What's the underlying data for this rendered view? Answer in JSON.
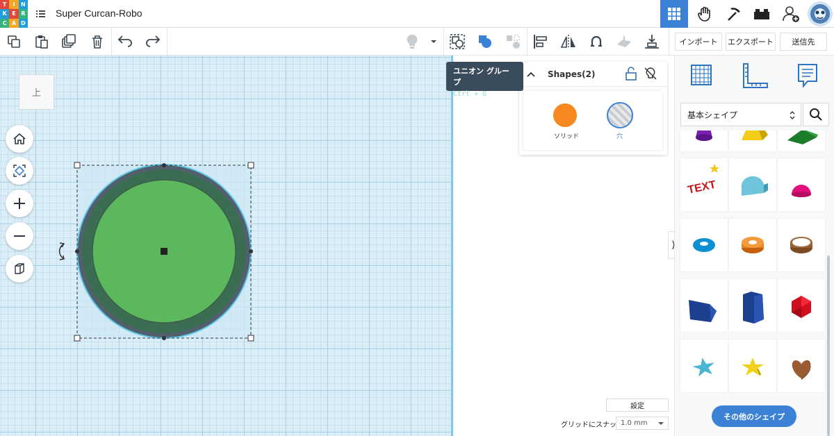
{
  "app": {
    "logo_letters": [
      "T",
      "I",
      "N",
      "K",
      "E",
      "R",
      "C",
      "A",
      "D"
    ],
    "project_title": "Super Curcan-Robo"
  },
  "toolbar": {
    "import_label": "インポート",
    "export_label": "エクスポート",
    "send_label": "送信先"
  },
  "viewcube": {
    "label": "上"
  },
  "tooltip": {
    "title": "ユニオン グループ",
    "shortcut": "Ctrl + G"
  },
  "shapes_panel": {
    "title": "Shapes(2)",
    "solid_label": "ソリッド",
    "hole_label": "穴"
  },
  "library": {
    "category": "基本シェイプ",
    "items": [
      "cone-purple",
      "pyramid-yellow",
      "roof-green",
      "text-red",
      "half-cylinder",
      "paraboloid",
      "torus-blue",
      "tube-orange",
      "ring-brown",
      "polygon-blue",
      "cylinder-blue",
      "icosahedron-red",
      "star-teal",
      "star-yellow",
      "heart-brown"
    ],
    "more_button": "その他のシェイプ"
  },
  "footer": {
    "settings_label": "設定",
    "snap_label": "グリッドにスナップ",
    "snap_value": "1.0 mm"
  },
  "colors": {
    "accent": "#3b82d6",
    "shape_green": "#5cb85c",
    "shape_dark": "#3a6d51",
    "solid_orange": "#f5891f",
    "tooltip_bg": "#3a4b5c"
  }
}
